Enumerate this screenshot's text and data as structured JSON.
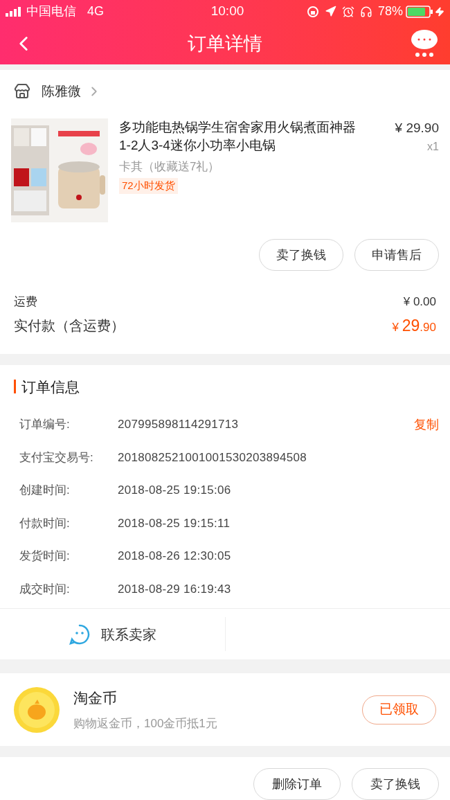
{
  "status_bar": {
    "carrier": "中国电信",
    "network": "4G",
    "time": "10:00",
    "battery": "78%"
  },
  "header": {
    "title": "订单详情"
  },
  "shop": {
    "name": "陈雅微"
  },
  "product": {
    "title": "多功能电热锅学生宿舍家用火锅煮面神器1-2人3-4迷你小功率小电锅",
    "price": "¥ 29.90",
    "quantity": "x1",
    "sku": "卡其（收藏送7礼）",
    "tag": "72小时发货",
    "actions": [
      "卖了换钱",
      "申请售后"
    ]
  },
  "costs": {
    "shipping_label": "运费",
    "shipping_value": "¥ 0.00",
    "paid_label": "实付款（含运费）",
    "paid_currency": "¥ ",
    "paid_integer": "29",
    "paid_decimal": ".90"
  },
  "order_info": {
    "title": "订单信息",
    "rows": [
      {
        "label": "订单编号:",
        "value": "207995898114291713",
        "action": "复制"
      },
      {
        "label": "支付宝交易号:",
        "value": "2018082521001001530203894508"
      },
      {
        "label": "创建时间:",
        "value": "2018-08-25 19:15:06"
      },
      {
        "label": "付款时间:",
        "value": "2018-08-25 19:15:11"
      },
      {
        "label": "发货时间:",
        "value": "2018-08-26 12:30:05"
      },
      {
        "label": "成交时间:",
        "value": "2018-08-29 16:19:43"
      }
    ],
    "contact": "联系卖家"
  },
  "coins": {
    "title": "淘金币",
    "subtitle": "购物返金币，100金币抵1元",
    "button": "已领取"
  },
  "bottom_actions": [
    "删除订单",
    "卖了换钱"
  ]
}
